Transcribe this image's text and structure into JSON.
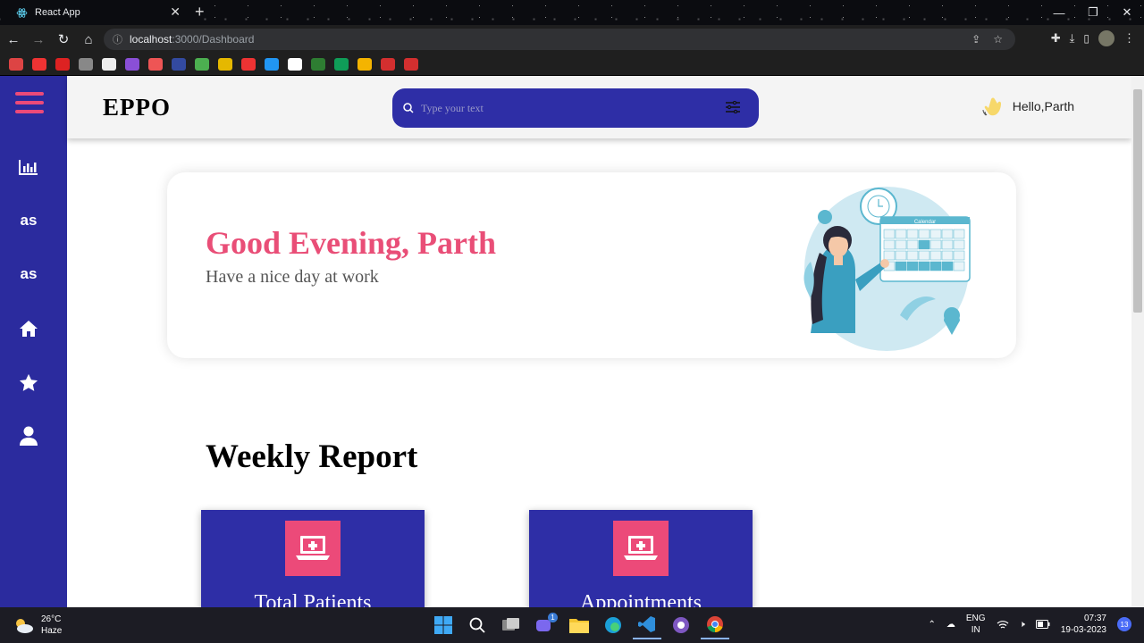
{
  "browser": {
    "tab_title": "React App",
    "url_host": "localhost",
    "url_path": ":3000/Dashboard",
    "bookmark_colors": [
      "#d44",
      "#e33",
      "#d22",
      "#888",
      "#eee",
      "#8a4fd6",
      "#e55",
      "#334aa0",
      "#4caf50",
      "#e5b800",
      "#e33",
      "#2196f3",
      "#fff",
      "#2e7d32",
      "#0f9d58",
      "#f4b400",
      "#d32f2f",
      "#d32f2f"
    ]
  },
  "header": {
    "logo": "EPPO",
    "search_placeholder": "Type your text",
    "greeting": "Hello,Parth"
  },
  "sidebar": {
    "items": [
      {
        "icon": "menu-icon"
      },
      {
        "icon": "bar-chart-icon"
      },
      {
        "icon": "lastfm-icon"
      },
      {
        "icon": "lastfm-icon"
      },
      {
        "icon": "home-icon"
      },
      {
        "icon": "star-icon"
      },
      {
        "icon": "user-icon"
      }
    ]
  },
  "welcome": {
    "title": "Good Evening, Parth",
    "subtitle": "Have a nice day at work",
    "calendar_label": "Calendar"
  },
  "report": {
    "title": "Weekly Report",
    "cards": [
      {
        "label": "Total Patients"
      },
      {
        "label": "Appointments"
      }
    ]
  },
  "taskbar": {
    "temperature": "26°C",
    "condition": "Haze",
    "language": "ENG",
    "region": "IN",
    "time": "07:37",
    "date": "19-03-2023",
    "notification_count": "13",
    "teams_badge": "1"
  },
  "colors": {
    "sidebar": "#2b2b9e",
    "accent_pink": "#e94e77",
    "card": "#2e2ea6"
  }
}
